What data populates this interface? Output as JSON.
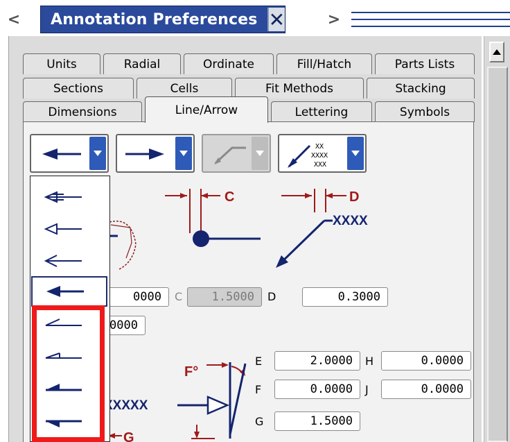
{
  "titlebar": {
    "title": "Annotation Preferences",
    "nav_left": "<",
    "nav_right": ">",
    "close": "✕"
  },
  "tabs": {
    "row1": [
      "Units",
      "Radial",
      "Ordinate",
      "Fill/Hatch",
      "Parts Lists"
    ],
    "row2": [
      "Sections",
      "Cells",
      "Fit Methods",
      "Stacking"
    ],
    "row3": [
      "Dimensions",
      "Line/Arrow",
      "Lettering",
      "Symbols"
    ],
    "active": "Line/Arrow"
  },
  "diagram": {
    "label_c": "C",
    "label_d": "D",
    "label_f": "F°",
    "label_g": "G",
    "xxxx": "XXXX",
    "xxxxx": "XXXXX",
    "grid_text": [
      "XX",
      "XXXX",
      "XXX"
    ]
  },
  "fields": {
    "row1_left": "0000",
    "c_label": "C",
    "c_value": "1.5000",
    "d_label": "D",
    "d_value": "0.3000",
    "row2_left": "0000",
    "e_label": "E",
    "e_value": "2.0000",
    "h_label": "H",
    "h_value": "0.0000",
    "f_label": "F",
    "f_value": "0.0000",
    "j_label": "J",
    "j_value": "0.0000",
    "g_label": "G",
    "g_value": "1.5000"
  },
  "dropdown": {
    "items": [
      "open-arrow-1",
      "open-arrow-2",
      "line-arrow",
      "filled-arrow",
      "half-line-arrow",
      "half-open-arrow",
      "half-filled-arrow-1",
      "half-filled-arrow-2"
    ],
    "selected_index": 3,
    "highlighted_range": [
      4,
      7
    ]
  },
  "colors": {
    "accent": "#2e5bb8",
    "arrow": "#14246e",
    "dim_red": "#a01a1a",
    "highlight": "#ef1b1b"
  }
}
